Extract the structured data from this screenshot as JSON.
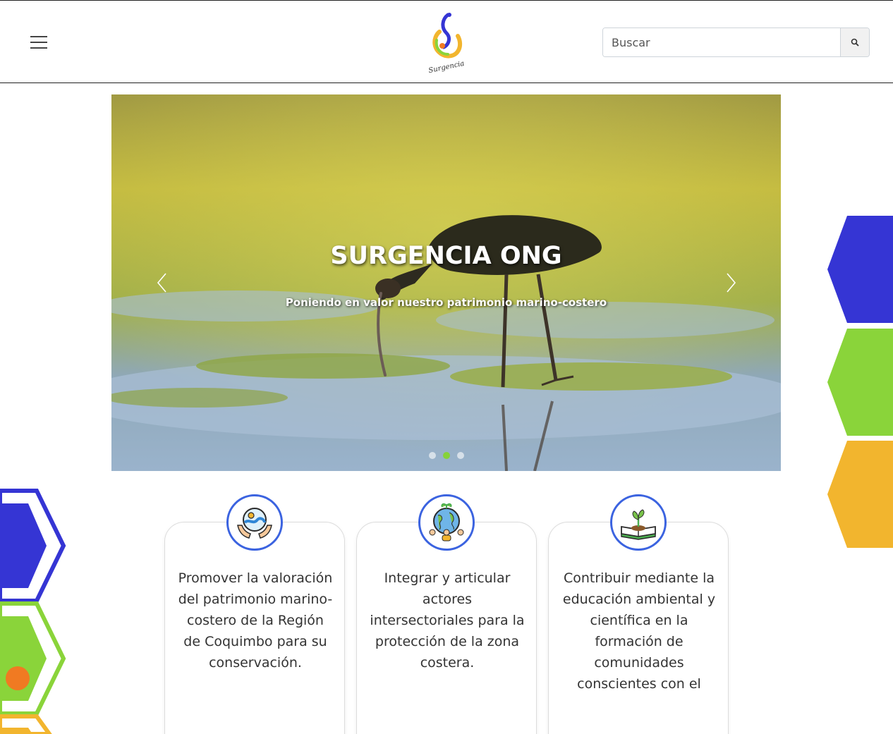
{
  "header": {
    "logo_text": "Surgencia",
    "search": {
      "placeholder": "Buscar"
    }
  },
  "carousel": {
    "title": "SURGENCIA ONG",
    "subtitle": "Poniendo en valor nuestro patrimonio marino-costero",
    "slide_count": 3,
    "active_slide": 2
  },
  "colors": {
    "blue": "#3535d4",
    "green": "#8ad43a",
    "yellow": "#f2b52e",
    "orange": "#f07a22",
    "icon_border": "#3b63e0"
  },
  "cards": [
    {
      "icon": "hands-ocean-icon",
      "text": "Promover la valoración del patrimonio marino-costero de la Región de Coquimbo para su conservación."
    },
    {
      "icon": "globe-people-icon",
      "text": "Integrar y articular actores intersectoriales para la protección de la zona costera."
    },
    {
      "icon": "book-sprout-icon",
      "text": "Contribuir mediante la educación ambiental y científica en la formación de comunidades conscientes con el"
    }
  ]
}
